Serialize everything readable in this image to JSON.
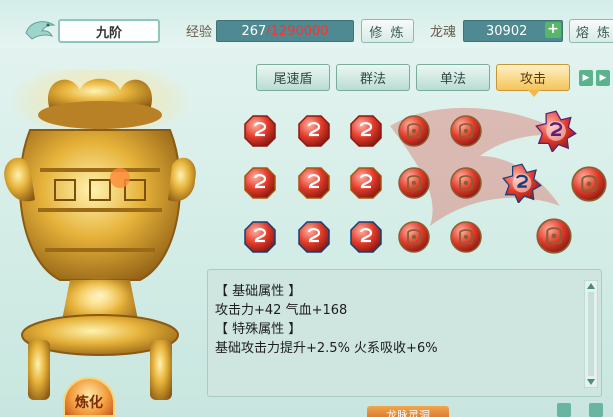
{
  "header": {
    "tier": "九阶",
    "exp_label": "经验",
    "exp_current": "267",
    "exp_separator": "/",
    "exp_max": "1290000",
    "train_button": "修 炼",
    "soul_label": "龙魂",
    "soul_value": "30902",
    "melt_button": "熔 炼"
  },
  "tabs": [
    {
      "label": "尾速盾",
      "active": false
    },
    {
      "label": "群法",
      "active": false
    },
    {
      "label": "单法",
      "active": false
    },
    {
      "label": "攻击",
      "active": true
    }
  ],
  "gem_rows": [
    {
      "color": "red",
      "items": [
        "red-gem",
        "red-gem",
        "red-gem",
        "locked-slot",
        "locked-slot"
      ]
    },
    {
      "color": "orange",
      "items": [
        "orange-gem",
        "orange-gem",
        "orange-gem",
        "locked-slot",
        "locked-slot"
      ]
    },
    {
      "color": "blue",
      "items": [
        "blue-gem",
        "blue-gem",
        "blue-gem",
        "locked-slot",
        "locked-slot"
      ]
    }
  ],
  "special_gems": [
    "purple-star-gem",
    "blue-star-gem",
    "locked-slot",
    "locked-slot"
  ],
  "attributes": {
    "base_header": "【 基础属性 】",
    "base_values": "攻击力+42  气血+168",
    "special_header": "【 特殊属性 】",
    "special_values": "基础攻击力提升+2.5%  火系吸收+6%"
  },
  "smelt_button": "炼化",
  "bottom_button": "龙脉灵洞",
  "colors": {
    "accent_red": "#ff3030",
    "active_tab": "#f5c45a",
    "panel_bg": "#cfe5df"
  }
}
